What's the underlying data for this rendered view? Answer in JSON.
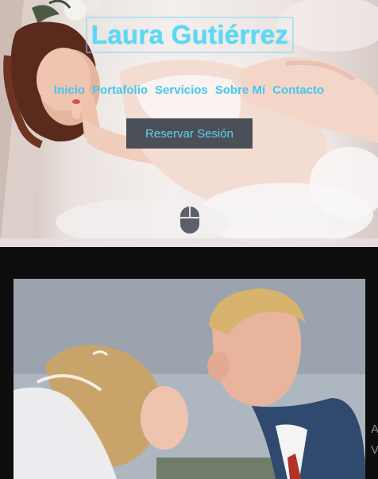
{
  "site": {
    "title": "Laura Gutiérrez"
  },
  "nav": {
    "items": [
      "Inicio",
      "Portafolio",
      "Servicios",
      "Sobre Mí",
      "Contacto"
    ]
  },
  "hero": {
    "cta_label": "Reservar Sesión",
    "scroll_icon": "mouse-icon"
  },
  "side_text": {
    "line1": "A",
    "line2": "V"
  },
  "colors": {
    "accent": "#43c8ef",
    "title": "#5ad9f7",
    "button_bg": "#4b5058",
    "page_bg": "#0e0e0e"
  }
}
